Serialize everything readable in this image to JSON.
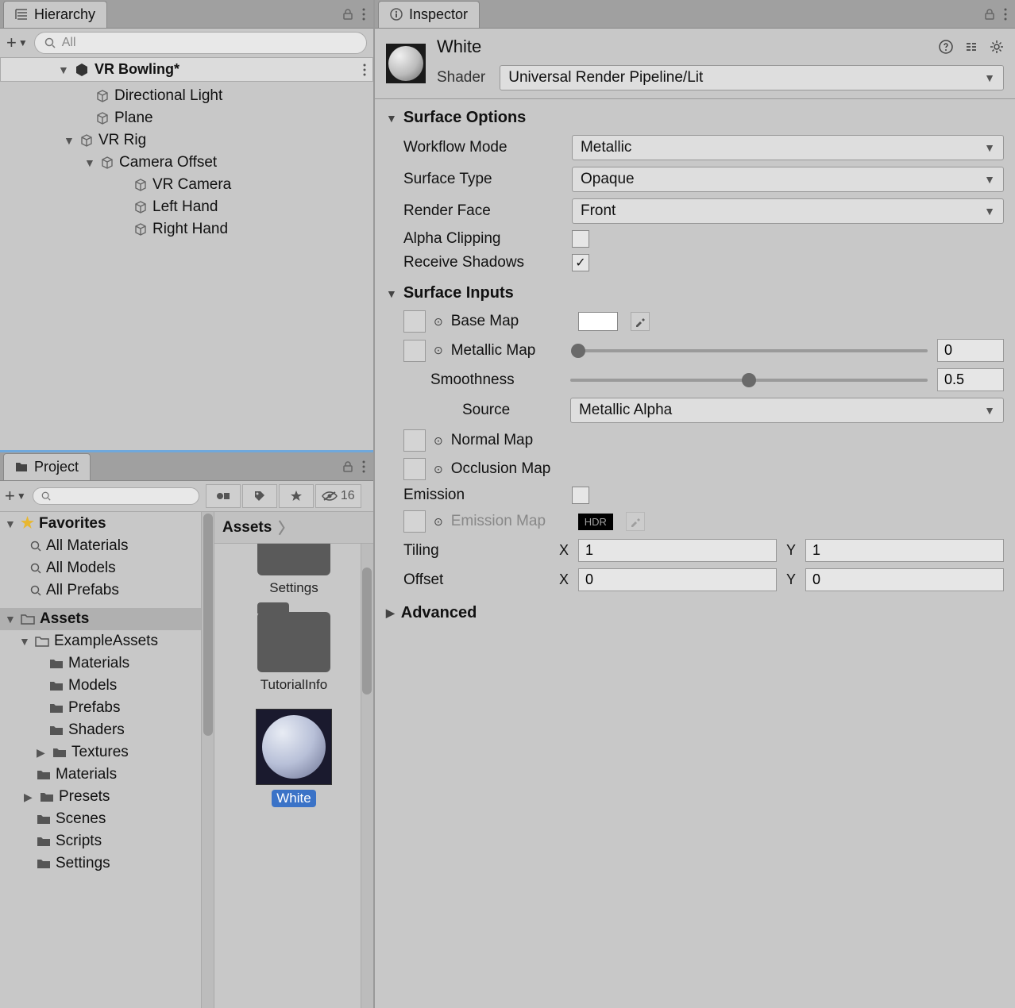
{
  "hierarchy": {
    "tab_label": "Hierarchy",
    "search_placeholder": "All",
    "scene_name": "VR Bowling*",
    "items": [
      {
        "level": 1,
        "label": "Directional Light",
        "arrow": ""
      },
      {
        "level": 1,
        "label": "Plane",
        "arrow": ""
      },
      {
        "level": 1,
        "label": "VR Rig",
        "arrow": "▼"
      },
      {
        "level": 2,
        "label": "Camera Offset",
        "arrow": "▼"
      },
      {
        "level": 3,
        "label": "VR Camera",
        "arrow": ""
      },
      {
        "level": 3,
        "label": "Left Hand",
        "arrow": ""
      },
      {
        "level": 3,
        "label": "Right Hand",
        "arrow": ""
      }
    ]
  },
  "project": {
    "tab_label": "Project",
    "hidden_count": "16",
    "favorites_label": "Favorites",
    "favs": [
      "All Materials",
      "All Models",
      "All Prefabs"
    ],
    "assets_label": "Assets",
    "folders": [
      {
        "label": "ExampleAssets",
        "arrow": "▼",
        "level": 1
      },
      {
        "label": "Materials",
        "arrow": "",
        "level": 2
      },
      {
        "label": "Models",
        "arrow": "",
        "level": 2
      },
      {
        "label": "Prefabs",
        "arrow": "",
        "level": 2
      },
      {
        "label": "Shaders",
        "arrow": "",
        "level": 2
      },
      {
        "label": "Textures",
        "arrow": "▶",
        "level": 2
      },
      {
        "label": "Materials",
        "arrow": "",
        "level": 1
      },
      {
        "label": "Presets",
        "arrow": "▶",
        "level": 1
      },
      {
        "label": "Scenes",
        "arrow": "",
        "level": 1
      },
      {
        "label": "Scripts",
        "arrow": "",
        "level": 1
      },
      {
        "label": "Settings",
        "arrow": "",
        "level": 1
      }
    ],
    "breadcrumb": "Assets",
    "grid_items": [
      "Settings",
      "TutorialInfo"
    ],
    "selected_material": "White"
  },
  "inspector": {
    "tab_label": "Inspector",
    "material_name": "White",
    "shader_label": "Shader",
    "shader_value": "Universal Render Pipeline/Lit",
    "sections": {
      "surface_options": {
        "title": "Surface Options",
        "workflow_label": "Workflow Mode",
        "workflow_value": "Metallic",
        "surface_type_label": "Surface Type",
        "surface_type_value": "Opaque",
        "render_face_label": "Render Face",
        "render_face_value": "Front",
        "alpha_clipping_label": "Alpha Clipping",
        "alpha_clipping_checked": false,
        "receive_shadows_label": "Receive Shadows",
        "receive_shadows_checked": true
      },
      "surface_inputs": {
        "title": "Surface Inputs",
        "base_map_label": "Base Map",
        "metallic_map_label": "Metallic Map",
        "metallic_value": "0",
        "smoothness_label": "Smoothness",
        "smoothness_value": "0.5",
        "source_label": "Source",
        "source_value": "Metallic Alpha",
        "normal_map_label": "Normal Map",
        "occlusion_map_label": "Occlusion Map",
        "emission_label": "Emission",
        "emission_checked": false,
        "emission_map_label": "Emission Map",
        "hdr_label": "HDR",
        "tiling_label": "Tiling",
        "tiling_x": "1",
        "tiling_y": "1",
        "offset_label": "Offset",
        "offset_x": "0",
        "offset_y": "0"
      },
      "advanced": {
        "title": "Advanced"
      }
    }
  }
}
